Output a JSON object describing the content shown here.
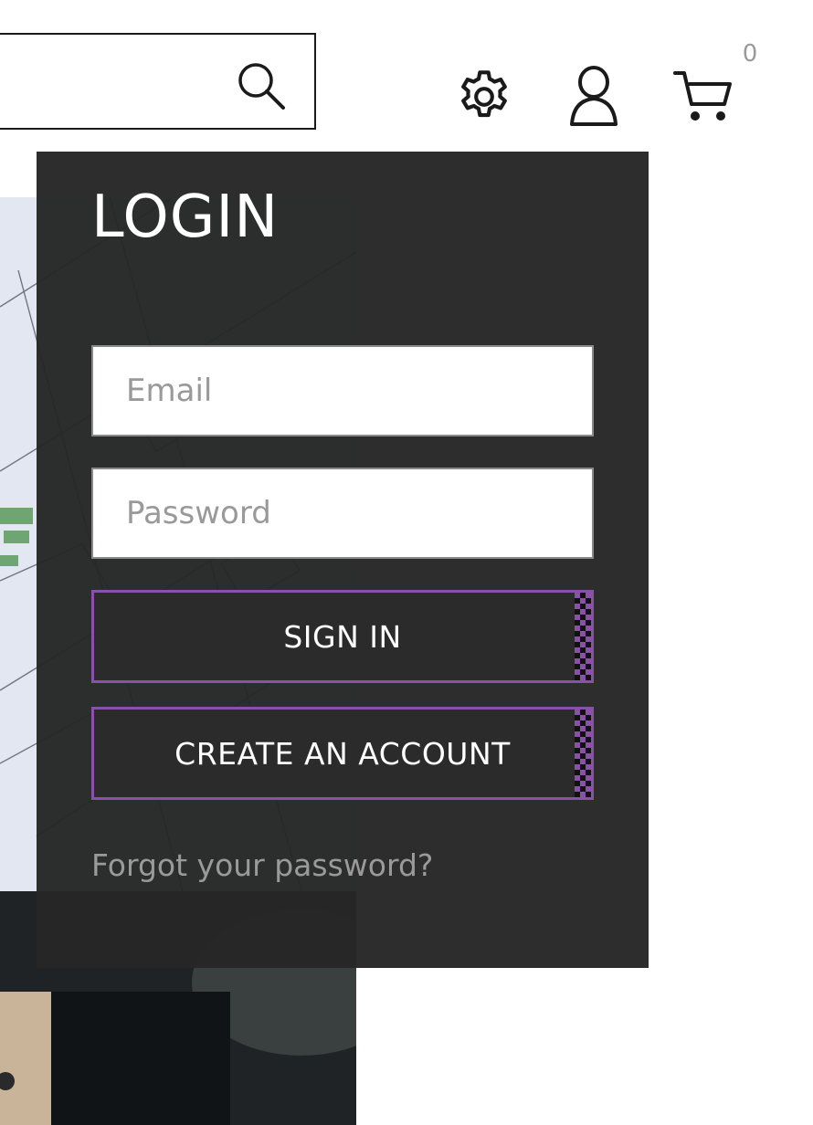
{
  "header": {
    "search": {
      "placeholder": "",
      "value": ""
    },
    "icons": {
      "search": "search-icon",
      "settings": "gear-icon",
      "account": "user-icon",
      "cart": "cart-icon"
    },
    "cart_count": "0"
  },
  "login": {
    "title": "LOGIN",
    "email_placeholder": "Email",
    "password_placeholder": "Password",
    "sign_in_label": "SIGN IN",
    "create_account_label": "CREATE AN ACCOUNT",
    "forgot_password_label": "Forgot your password?"
  },
  "colors": {
    "panel_bg": "#2b2b2b",
    "button_border": "#8b50a8",
    "placeholder": "#999999",
    "text_light": "#ffffff",
    "muted": "#9a9a9a"
  }
}
